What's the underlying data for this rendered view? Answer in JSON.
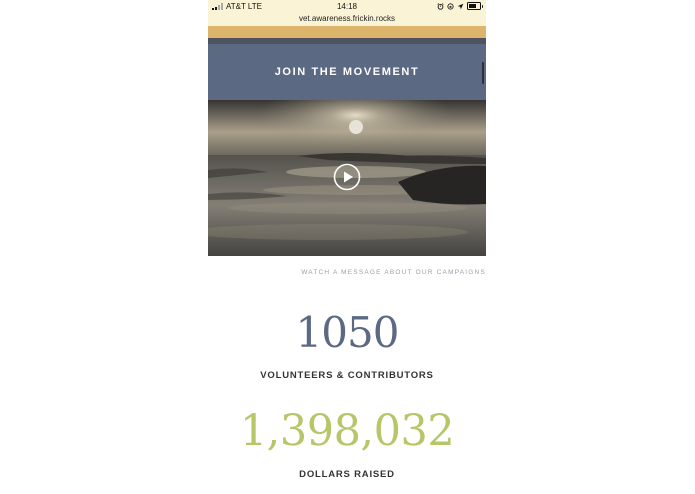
{
  "status_bar": {
    "carrier": "AT&T LTE",
    "time": "14:18",
    "url": "vet.awareness.frickin.rocks",
    "icons": [
      "alarm-icon",
      "screen-lock-icon",
      "location-icon",
      "battery-icon"
    ]
  },
  "hero": {
    "join_label": "JOIN THE MOVEMENT"
  },
  "video": {
    "caption": "WATCH A MESSAGE ABOUT OUR CAMPAIGNS",
    "play_icon": "play-icon"
  },
  "stats": [
    {
      "value": "1050",
      "label": "VOLUNTEERS & CONTRIBUTORS"
    },
    {
      "value": "1,398,032",
      "label": "DOLLARS RAISED"
    }
  ],
  "colors": {
    "nav_bar": "#5c6983",
    "gold_strip": "#dcb46c",
    "volunteers_number": "#5c6983",
    "dollars_number": "#b6c76a",
    "status_bar_bg": "#fbf3d6"
  }
}
